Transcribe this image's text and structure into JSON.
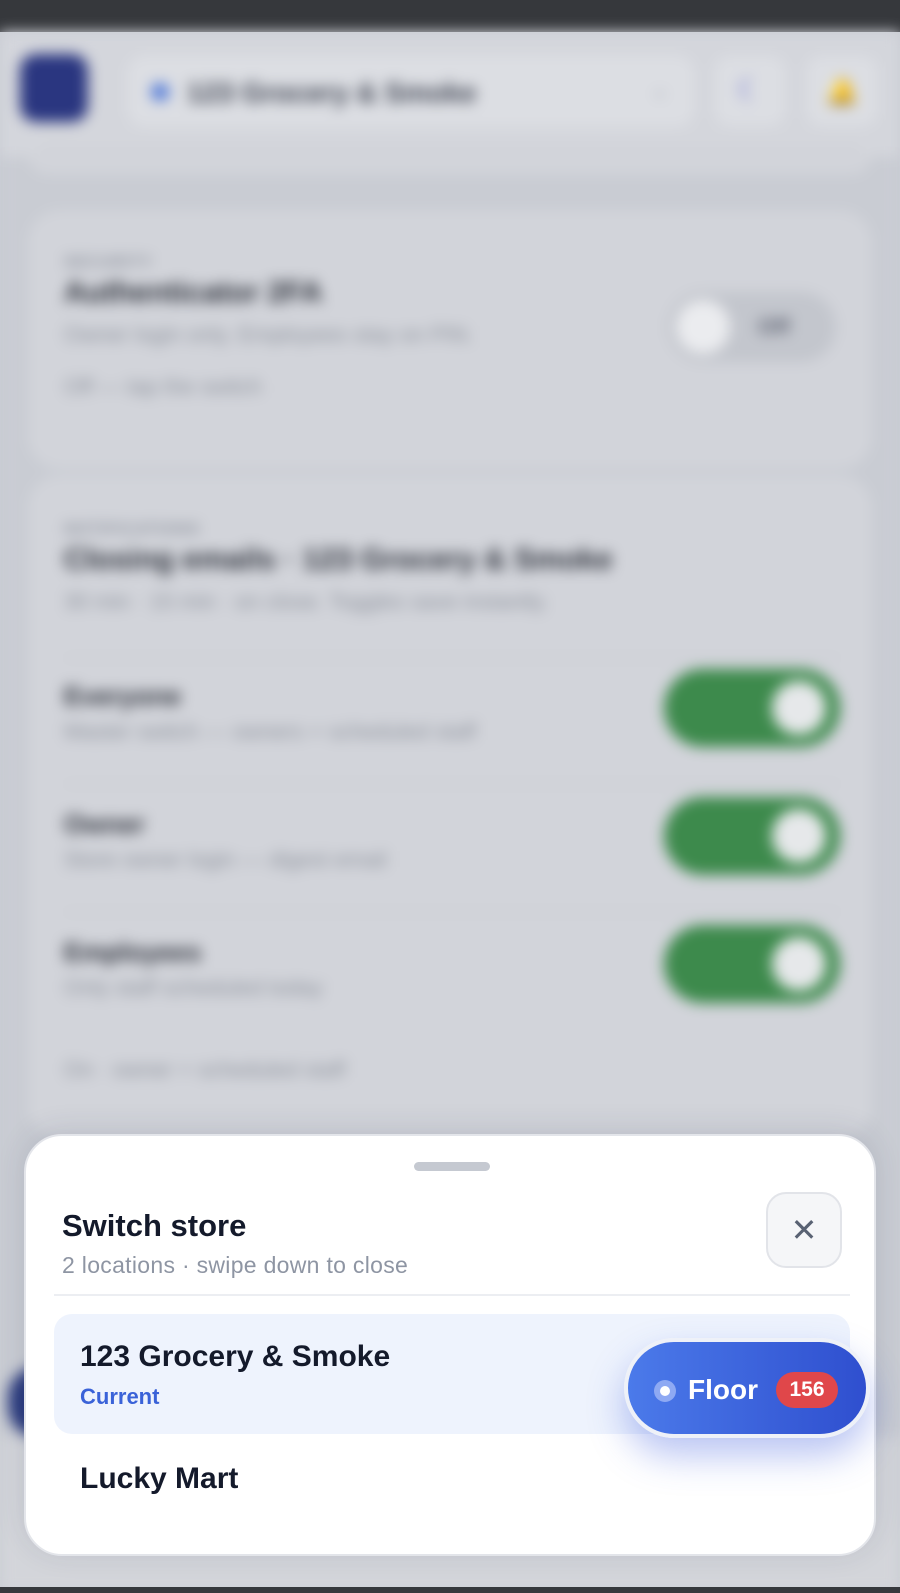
{
  "background": {
    "header": {
      "store_name": "123 Grocery & Smoke",
      "chevron_icon": "chevron-down-icon",
      "moon_icon": "moon-icon",
      "bell_icon": "bell-icon"
    },
    "auth_card": {
      "eyebrow": "SECURITY",
      "title": "Authenticator 2FA",
      "subtitle": "Owner login only. Employees stay on PIN.",
      "note": "Off — tap the switch",
      "toggle_label": "Off"
    },
    "closing_card": {
      "eyebrow": "NOTIFICATIONS",
      "title": "Closing emails · 123 Grocery & Smoke",
      "subtitle": "30 min · 15 min · on close. Toggles save instantly.",
      "rows": [
        {
          "title": "Everyone",
          "subtitle": "Master switch — owners + scheduled staff"
        },
        {
          "title": "Owner",
          "subtitle": "Store owner login — digest email"
        },
        {
          "title": "Employees",
          "subtitle": "Only staff scheduled today"
        }
      ],
      "footer": "On · owner + scheduled staff"
    }
  },
  "sheet": {
    "title": "Switch store",
    "subtitle": "2 locations · swipe down to close",
    "close_icon": "close-icon",
    "close_glyph": "✕",
    "stores": [
      {
        "name": "123 Grocery & Smoke",
        "status": "Current"
      },
      {
        "name": "Lucky Mart"
      }
    ]
  },
  "floor_fab": {
    "label": "Floor",
    "badge": "156"
  },
  "colors": {
    "accent": "#3a62d8",
    "fab_start": "#4b7aea",
    "fab_end": "#2f4fcf",
    "badge": "#e0474a",
    "toggle_on": "#3d8a4c"
  }
}
